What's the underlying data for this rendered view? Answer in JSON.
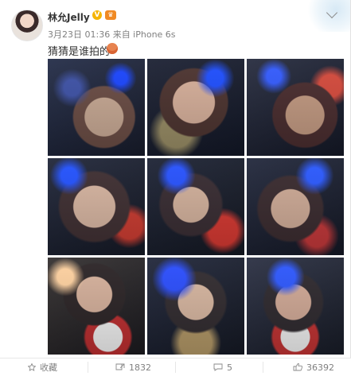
{
  "post": {
    "username": "林允Jelly",
    "verified_badge": "V",
    "meta": "3月23日 01:36 来自 iPhone 6s",
    "text": "猜猜是谁拍的"
  },
  "gallery": {
    "photo_labels": [
      "",
      "",
      "",
      "",
      "",
      "",
      "",
      "",
      ""
    ]
  },
  "actions": [
    {
      "label": "收藏",
      "icon": "star-icon"
    },
    {
      "label": "1832",
      "icon": "share-icon"
    },
    {
      "label": "5",
      "icon": "comment-icon"
    },
    {
      "label": "36392",
      "icon": "like-icon"
    }
  ],
  "colors": {
    "verified": "#f5b400",
    "text": "#333333",
    "muted": "#808080"
  }
}
